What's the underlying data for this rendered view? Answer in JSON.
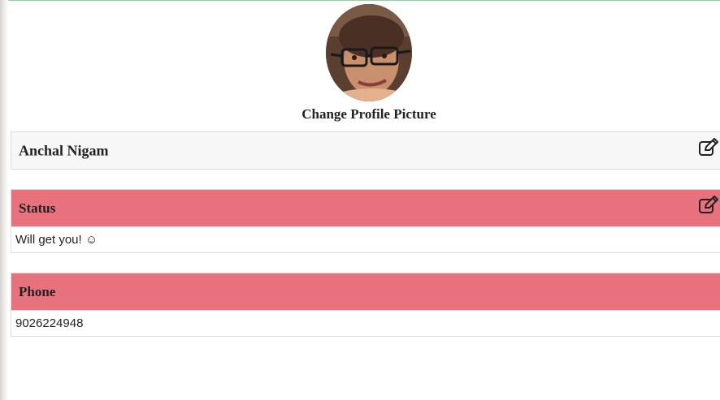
{
  "profile": {
    "change_picture_label": "Change Profile Picture",
    "name": "Anchal Nigam"
  },
  "status": {
    "header": "Status",
    "text": "Will get you! ☺"
  },
  "phone": {
    "header": "Phone",
    "number": "9026224948"
  },
  "icons": {
    "edit_name": "edit-icon",
    "edit_status": "edit-icon"
  },
  "colors": {
    "section_header": "#e8717e",
    "name_header": "#f7f7f7",
    "top_accent": "#8fd19e"
  }
}
